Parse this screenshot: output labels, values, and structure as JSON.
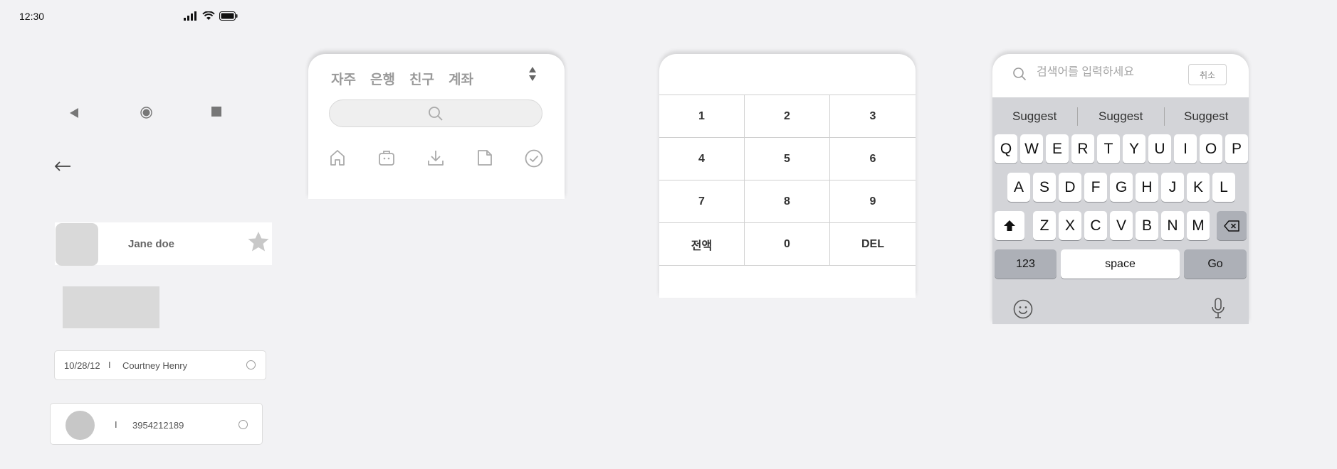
{
  "status_bar": {
    "time": "12:30"
  },
  "contact": {
    "name": "Jane doe"
  },
  "record": {
    "date": "10/28/12",
    "separator": "I",
    "name": "Courtney Henry"
  },
  "account": {
    "separator": "I",
    "number": "3954212189"
  },
  "tabs": [
    "자주",
    "은행",
    "친구",
    "계좌"
  ],
  "numpad": {
    "keys": [
      "1",
      "2",
      "3",
      "4",
      "5",
      "6",
      "7",
      "8",
      "9",
      "전액",
      "0",
      "DEL"
    ]
  },
  "keyboard": {
    "search_placeholder": "검색어를 입력하세요",
    "cancel_label": "취소",
    "suggestions": [
      "Suggest",
      "Suggest",
      "Suggest"
    ],
    "row1": [
      "Q",
      "W",
      "E",
      "R",
      "T",
      "Y",
      "U",
      "I",
      "O",
      "P"
    ],
    "row2": [
      "A",
      "S",
      "D",
      "F",
      "G",
      "H",
      "J",
      "K",
      "L"
    ],
    "row3": [
      "Z",
      "X",
      "C",
      "V",
      "B",
      "N",
      "M"
    ],
    "numbers_label": "123",
    "space_label": "space",
    "go_label": "Go"
  }
}
